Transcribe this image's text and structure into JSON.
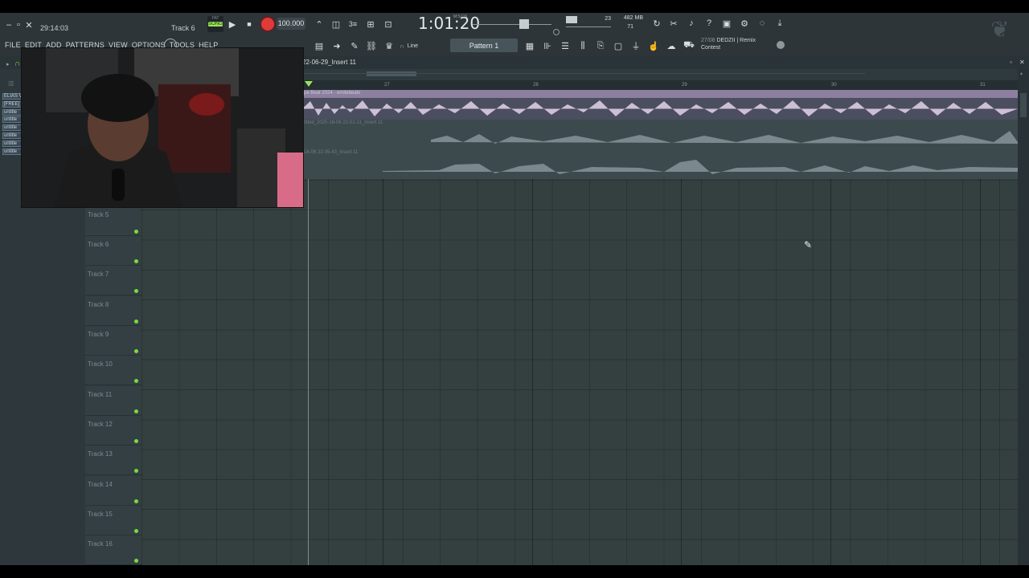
{
  "window": {
    "minimize_icon": "minimize-icon",
    "restore_icon": "restore-icon",
    "close_icon": "close-icon",
    "clock": "29:14:03",
    "current_track": "Track 6"
  },
  "transport": {
    "pat_label": "PAT",
    "song_label": "SONG",
    "tempo": "100.000",
    "time": "1:01:20",
    "time_label": "M:S:CS"
  },
  "system": {
    "cpu_value": "23",
    "memory": "482 MB",
    "polyphony": "71"
  },
  "menu": {
    "items": [
      "FILE",
      "EDIT",
      "ADD",
      "PATTERNS",
      "VIEW",
      "OPTIONS",
      "TOOLS",
      "HELP"
    ]
  },
  "toolbar2": {
    "snap_value": "Line",
    "pattern": "Pattern 1",
    "news_date": "27/08",
    "news_text": "DEDZII | Remix",
    "news_sub": "Contest"
  },
  "playlist": {
    "title": "22-06-29_Insert 11",
    "ruler": [
      "27",
      "28",
      "29",
      "30",
      "31"
    ],
    "clips": [
      {
        "label": "pe Beat 2024 - emitebeats"
      },
      {
        "label": "titled_2025-16-06 22-01-11_Insert 11"
      },
      {
        "label": "16-06 22-05-43_Insert 11"
      }
    ],
    "tracks": [
      "Track 5",
      "Track 6",
      "Track 7",
      "Track 8",
      "Track 9",
      "Track 10",
      "Track 11",
      "Track 12",
      "Track 13",
      "Track 14",
      "Track 15",
      "Track 16"
    ]
  },
  "browser": {
    "items": [
      "ELIAS V",
      "[FREE]",
      "untitle",
      "untitle",
      "untitle",
      "untitle",
      "untitle",
      "untitle"
    ]
  },
  "colors": {
    "accent_green": "#7ddb3a",
    "record_red": "#e03a3a",
    "clip_purple": "#bda8c8",
    "waveform_grey": "#8e9aa0"
  }
}
